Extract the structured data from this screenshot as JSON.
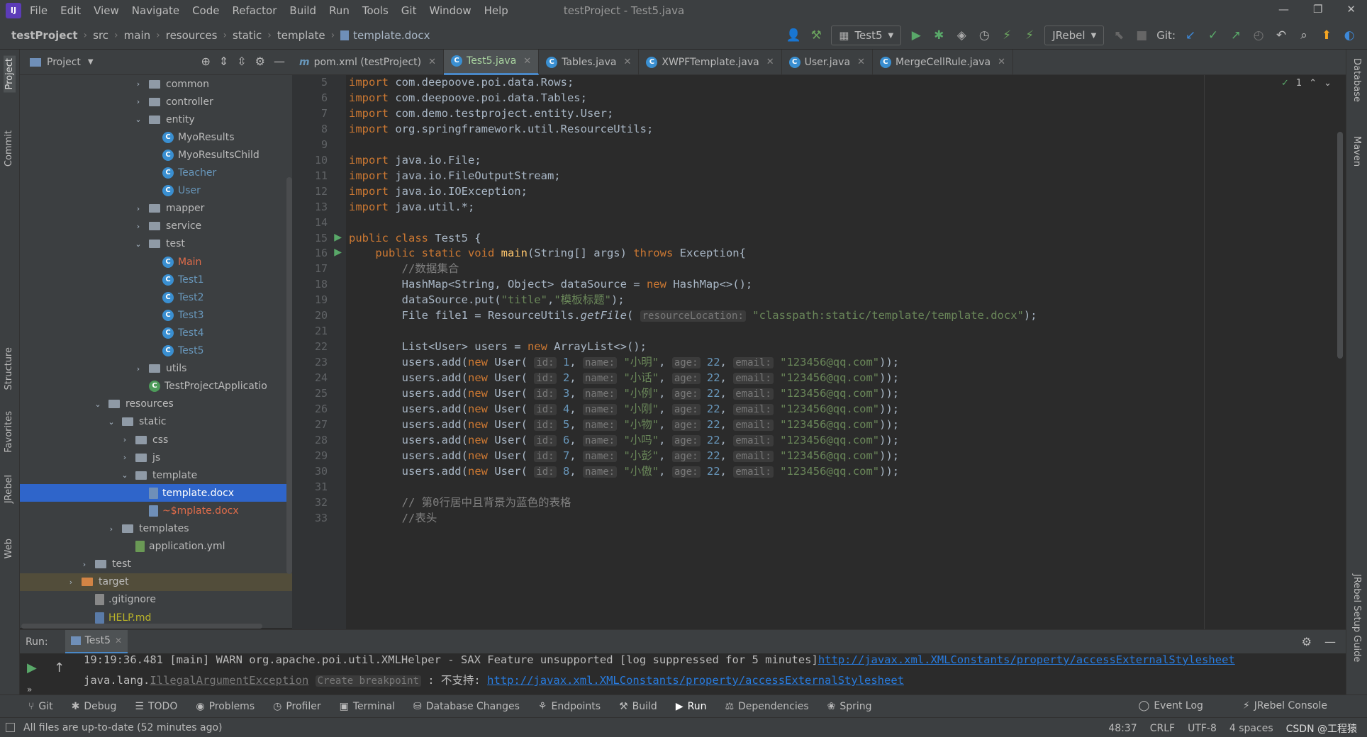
{
  "menu": {
    "items": [
      "File",
      "Edit",
      "View",
      "Navigate",
      "Code",
      "Refactor",
      "Build",
      "Run",
      "Tools",
      "Git",
      "Window",
      "Help"
    ],
    "title": "testProject - Test5.java"
  },
  "breadcrumb": [
    "testProject",
    "src",
    "main",
    "resources",
    "static",
    "template",
    "template.docx"
  ],
  "toolbar": {
    "run_config": "Test5",
    "jrebel": "JRebel",
    "git_label": "Git:"
  },
  "project_panel": {
    "title": "Project"
  },
  "tree": [
    {
      "label": "common",
      "indent": 0,
      "type": "folder",
      "arrow": "›"
    },
    {
      "label": "controller",
      "indent": 0,
      "type": "folder",
      "arrow": "›"
    },
    {
      "label": "entity",
      "indent": 0,
      "type": "folder",
      "arrow": "⌄"
    },
    {
      "label": "MyoResults",
      "indent": 1,
      "type": "class"
    },
    {
      "label": "MyoResultsChild",
      "indent": 1,
      "type": "class"
    },
    {
      "label": "Teacher",
      "indent": 1,
      "type": "class",
      "color": "#6897bb"
    },
    {
      "label": "User",
      "indent": 1,
      "type": "class",
      "color": "#6897bb"
    },
    {
      "label": "mapper",
      "indent": 0,
      "type": "folder",
      "arrow": "›"
    },
    {
      "label": "service",
      "indent": 0,
      "type": "folder",
      "arrow": "›"
    },
    {
      "label": "test",
      "indent": 0,
      "type": "folder",
      "arrow": "⌄"
    },
    {
      "label": "Main",
      "indent": 1,
      "type": "class",
      "color": "#e06c4a"
    },
    {
      "label": "Test1",
      "indent": 1,
      "type": "class",
      "color": "#6897bb"
    },
    {
      "label": "Test2",
      "indent": 1,
      "type": "class",
      "color": "#6897bb"
    },
    {
      "label": "Test3",
      "indent": 1,
      "type": "class",
      "color": "#6897bb"
    },
    {
      "label": "Test4",
      "indent": 1,
      "type": "class",
      "color": "#6897bb"
    },
    {
      "label": "Test5",
      "indent": 1,
      "type": "class",
      "color": "#6897bb"
    },
    {
      "label": "utils",
      "indent": 0,
      "type": "folder",
      "arrow": "›"
    },
    {
      "label": "TestProjectApplicatio",
      "indent": 0,
      "type": "class",
      "green": true
    },
    {
      "label": "resources",
      "indent": -3,
      "type": "folder",
      "arrow": "⌄"
    },
    {
      "label": "static",
      "indent": -2,
      "type": "folder",
      "arrow": "⌄"
    },
    {
      "label": "css",
      "indent": -1,
      "type": "folder",
      "arrow": "›"
    },
    {
      "label": "js",
      "indent": -1,
      "type": "folder",
      "arrow": "›"
    },
    {
      "label": "template",
      "indent": -1,
      "type": "folder",
      "arrow": "⌄"
    },
    {
      "label": "template.docx",
      "indent": 0,
      "type": "file",
      "selected": true
    },
    {
      "label": "~$mplate.docx",
      "indent": 0,
      "type": "file",
      "color": "#e06c4a"
    },
    {
      "label": "templates",
      "indent": -2,
      "type": "folder",
      "arrow": "›"
    },
    {
      "label": "application.yml",
      "indent": -1,
      "type": "yml"
    },
    {
      "label": "test",
      "indent": -4,
      "type": "folder",
      "arrow": "›"
    },
    {
      "label": "target",
      "indent": -5,
      "type": "folder",
      "arrow": "›",
      "orange": true
    },
    {
      "label": ".gitignore",
      "indent": -4,
      "type": "git"
    },
    {
      "label": "HELP.md",
      "indent": -4,
      "type": "md",
      "color": "#bbb529"
    }
  ],
  "tabs": [
    {
      "label": "pom.xml (testProject)",
      "icon": "m"
    },
    {
      "label": "Test5.java",
      "icon": "c",
      "active": true
    },
    {
      "label": "Tables.java",
      "icon": "c"
    },
    {
      "label": "XWPFTemplate.java",
      "icon": "c"
    },
    {
      "label": "User.java",
      "icon": "c"
    },
    {
      "label": "MergeCellRule.java",
      "icon": "c"
    }
  ],
  "editor": {
    "inspection_count": "1",
    "lines": [
      {
        "n": "5",
        "html": "<span class='kw'>import</span> com.deepoove.poi.data.Rows;"
      },
      {
        "n": "6",
        "html": "<span class='kw'>import</span> com.deepoove.poi.data.Tables;"
      },
      {
        "n": "7",
        "html": "<span class='kw'>import</span> com.demo.testproject.entity.User;"
      },
      {
        "n": "8",
        "html": "<span class='kw'>import</span> org.springframework.util.ResourceUtils;"
      },
      {
        "n": "9",
        "html": ""
      },
      {
        "n": "10",
        "html": "<span class='kw'>import</span> java.io.File;"
      },
      {
        "n": "11",
        "html": "<span class='kw'>import</span> java.io.FileOutputStream;"
      },
      {
        "n": "12",
        "html": "<span class='kw'>import</span> java.io.IOException;"
      },
      {
        "n": "13",
        "html": "<span class='kw'>import</span> java.util.*;"
      },
      {
        "n": "14",
        "html": ""
      },
      {
        "n": "15",
        "html": "<span class='kw'>public class</span> Test5 {"
      },
      {
        "n": "16",
        "html": "    <span class='kw'>public static void</span> <span class='fn'>main</span>(String[] args) <span class='kw'>throws</span> Exception{"
      },
      {
        "n": "17",
        "html": "        <span class='cm'>//数据集合</span>"
      },
      {
        "n": "18",
        "html": "        HashMap&lt;String, Object&gt; dataSource = <span class='kw'>new</span> HashMap&lt;&gt;();"
      },
      {
        "n": "19",
        "html": "        dataSource.put(<span class='str'>\"title\"</span>,<span class='str'>\"模板标题\"</span>);"
      },
      {
        "n": "20",
        "html": "        File file1 = ResourceUtils.<span class='it'>getFile</span>( <span class='hint'>resourceLocation:</span> <span class='str'>\"classpath:static/template/template.docx\"</span>);"
      },
      {
        "n": "21",
        "html": ""
      },
      {
        "n": "22",
        "html": "        List&lt;User&gt; users = <span class='kw'>new</span> ArrayList&lt;&gt;();"
      },
      {
        "n": "23",
        "html": "        users.add(<span class='kw'>new</span> User( <span class='hint'>id:</span> <span style='color:#6897bb'>1</span>, <span class='hint'>name:</span> <span class='str'>\"小明\"</span>, <span class='hint'>age:</span> <span style='color:#6897bb'>22</span>, <span class='hint'>email:</span> <span class='str'>\"123456@qq.com\"</span>));"
      },
      {
        "n": "24",
        "html": "        users.add(<span class='kw'>new</span> User( <span class='hint'>id:</span> <span style='color:#6897bb'>2</span>, <span class='hint'>name:</span> <span class='str'>\"小话\"</span>, <span class='hint'>age:</span> <span style='color:#6897bb'>22</span>, <span class='hint'>email:</span> <span class='str'>\"123456@qq.com\"</span>));"
      },
      {
        "n": "25",
        "html": "        users.add(<span class='kw'>new</span> User( <span class='hint'>id:</span> <span style='color:#6897bb'>3</span>, <span class='hint'>name:</span> <span class='str'>\"小例\"</span>, <span class='hint'>age:</span> <span style='color:#6897bb'>22</span>, <span class='hint'>email:</span> <span class='str'>\"123456@qq.com\"</span>));"
      },
      {
        "n": "26",
        "html": "        users.add(<span class='kw'>new</span> User( <span class='hint'>id:</span> <span style='color:#6897bb'>4</span>, <span class='hint'>name:</span> <span class='str'>\"小刚\"</span>, <span class='hint'>age:</span> <span style='color:#6897bb'>22</span>, <span class='hint'>email:</span> <span class='str'>\"123456@qq.com\"</span>));"
      },
      {
        "n": "27",
        "html": "        users.add(<span class='kw'>new</span> User( <span class='hint'>id:</span> <span style='color:#6897bb'>5</span>, <span class='hint'>name:</span> <span class='str'>\"小物\"</span>, <span class='hint'>age:</span> <span style='color:#6897bb'>22</span>, <span class='hint'>email:</span> <span class='str'>\"123456@qq.com\"</span>));"
      },
      {
        "n": "28",
        "html": "        users.add(<span class='kw'>new</span> User( <span class='hint'>id:</span> <span style='color:#6897bb'>6</span>, <span class='hint'>name:</span> <span class='str'>\"小吗\"</span>, <span class='hint'>age:</span> <span style='color:#6897bb'>22</span>, <span class='hint'>email:</span> <span class='str'>\"123456@qq.com\"</span>));"
      },
      {
        "n": "29",
        "html": "        users.add(<span class='kw'>new</span> User( <span class='hint'>id:</span> <span style='color:#6897bb'>7</span>, <span class='hint'>name:</span> <span class='str'>\"小彭\"</span>, <span class='hint'>age:</span> <span style='color:#6897bb'>22</span>, <span class='hint'>email:</span> <span class='str'>\"123456@qq.com\"</span>));"
      },
      {
        "n": "30",
        "html": "        users.add(<span class='kw'>new</span> User( <span class='hint'>id:</span> <span style='color:#6897bb'>8</span>, <span class='hint'>name:</span> <span class='str'>\"小傲\"</span>, <span class='hint'>age:</span> <span style='color:#6897bb'>22</span>, <span class='hint'>email:</span> <span class='str'>\"123456@qq.com\"</span>));"
      },
      {
        "n": "31",
        "html": ""
      },
      {
        "n": "32",
        "html": "        <span class='cm'>// 第0行居中且背景为蓝色的表格</span>"
      },
      {
        "n": "33",
        "html": "        <span class='cm'>//表头</span>"
      }
    ]
  },
  "run": {
    "label": "Run:",
    "tab": "Test5",
    "line1_prefix": "19:19:36.481 [main] WARN org.apache.poi.util.XMLHelper - SAX Feature unsupported [log suppressed for 5 minutes]",
    "line1_link": "http://javax.xml.XMLConstants/property/accessExternalStylesheet",
    "line2_prefix": "java.lang.",
    "line2_exc": "IllegalArgumentException",
    "line2_hint": "Create breakpoint",
    "line2_mid": " : 不支持: ",
    "line2_link": "http://javax.xml.XMLConstants/property/accessExternalStylesheet"
  },
  "toolwindows": [
    "Git",
    "Debug",
    "TODO",
    "Problems",
    "Profiler",
    "Terminal",
    "Database Changes",
    "Endpoints",
    "Build",
    "Run",
    "Dependencies",
    "Spring"
  ],
  "toolwindows_right": [
    "Event Log",
    "JRebel Console"
  ],
  "status": {
    "message": "All files are up-to-date (52 minutes ago)",
    "position": "48:37",
    "line_sep": "CRLF",
    "encoding": "UTF-8",
    "indent": "4 spaces",
    "watermark": "CSDN @工程猿"
  },
  "left_strip": [
    "Project",
    "Commit",
    "Structure",
    "Favorites",
    "JRebel",
    "Web"
  ],
  "right_strip": [
    "Database",
    "Maven",
    "JRebel Setup Guide"
  ]
}
